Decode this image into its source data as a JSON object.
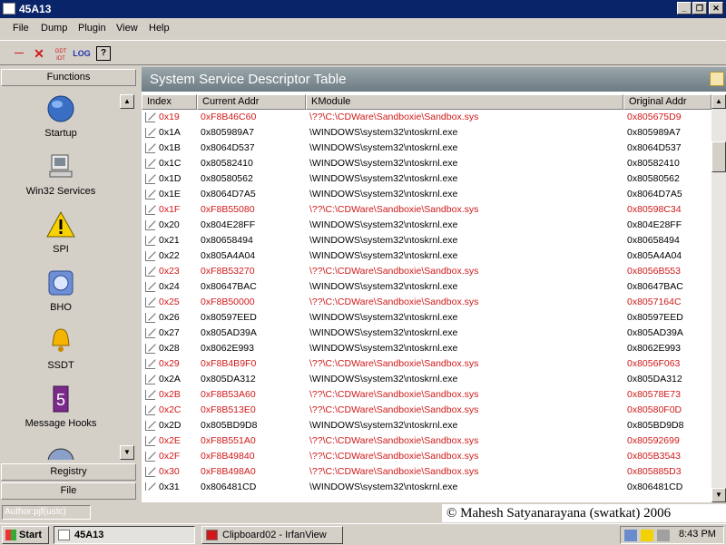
{
  "window": {
    "title": "45A13"
  },
  "window_controls": {
    "minimize": "_",
    "restore": "❐",
    "close": "✕"
  },
  "menu": [
    "File",
    "Dump",
    "Plugin",
    "View",
    "Help"
  ],
  "toolbar": {
    "minus": "—",
    "delete": "✕",
    "gdt_idt": "GDT IDT",
    "log": "LOG",
    "help": "?"
  },
  "left_panel": {
    "header": "Functions",
    "items": [
      "Startup",
      "Win32 Services",
      "SPI",
      "BHO",
      "SSDT",
      "Message Hooks"
    ],
    "footer_groups": [
      "Registry",
      "File"
    ]
  },
  "section": {
    "title": "System Service Descriptor Table"
  },
  "table": {
    "columns": [
      "Index",
      "Current Addr",
      "KModule",
      "Original Addr"
    ],
    "rows": [
      {
        "index": "0x19",
        "current": "0xF8B46C60",
        "module": "\\??\\C:\\CDWare\\Sandboxie\\Sandbox.sys",
        "original": "0x805675D9",
        "hooked": true
      },
      {
        "index": "0x1A",
        "current": "0x805989A7",
        "module": "\\WINDOWS\\system32\\ntoskrnl.exe",
        "original": "0x805989A7",
        "hooked": false
      },
      {
        "index": "0x1B",
        "current": "0x8064D537",
        "module": "\\WINDOWS\\system32\\ntoskrnl.exe",
        "original": "0x8064D537",
        "hooked": false
      },
      {
        "index": "0x1C",
        "current": "0x80582410",
        "module": "\\WINDOWS\\system32\\ntoskrnl.exe",
        "original": "0x80582410",
        "hooked": false
      },
      {
        "index": "0x1D",
        "current": "0x80580562",
        "module": "\\WINDOWS\\system32\\ntoskrnl.exe",
        "original": "0x80580562",
        "hooked": false
      },
      {
        "index": "0x1E",
        "current": "0x8064D7A5",
        "module": "\\WINDOWS\\system32\\ntoskrnl.exe",
        "original": "0x8064D7A5",
        "hooked": false
      },
      {
        "index": "0x1F",
        "current": "0xF8B55080",
        "module": "\\??\\C:\\CDWare\\Sandboxie\\Sandbox.sys",
        "original": "0x80598C34",
        "hooked": true
      },
      {
        "index": "0x20",
        "current": "0x804E28FF",
        "module": "\\WINDOWS\\system32\\ntoskrnl.exe",
        "original": "0x804E28FF",
        "hooked": false
      },
      {
        "index": "0x21",
        "current": "0x80658494",
        "module": "\\WINDOWS\\system32\\ntoskrnl.exe",
        "original": "0x80658494",
        "hooked": false
      },
      {
        "index": "0x22",
        "current": "0x805A4A04",
        "module": "\\WINDOWS\\system32\\ntoskrnl.exe",
        "original": "0x805A4A04",
        "hooked": false
      },
      {
        "index": "0x23",
        "current": "0xF8B53270",
        "module": "\\??\\C:\\CDWare\\Sandboxie\\Sandbox.sys",
        "original": "0x8056B553",
        "hooked": true
      },
      {
        "index": "0x24",
        "current": "0x80647BAC",
        "module": "\\WINDOWS\\system32\\ntoskrnl.exe",
        "original": "0x80647BAC",
        "hooked": false
      },
      {
        "index": "0x25",
        "current": "0xF8B50000",
        "module": "\\??\\C:\\CDWare\\Sandboxie\\Sandbox.sys",
        "original": "0x8057164C",
        "hooked": true
      },
      {
        "index": "0x26",
        "current": "0x80597EED",
        "module": "\\WINDOWS\\system32\\ntoskrnl.exe",
        "original": "0x80597EED",
        "hooked": false
      },
      {
        "index": "0x27",
        "current": "0x805AD39A",
        "module": "\\WINDOWS\\system32\\ntoskrnl.exe",
        "original": "0x805AD39A",
        "hooked": false
      },
      {
        "index": "0x28",
        "current": "0x8062E993",
        "module": "\\WINDOWS\\system32\\ntoskrnl.exe",
        "original": "0x8062E993",
        "hooked": false
      },
      {
        "index": "0x29",
        "current": "0xF8B4B9F0",
        "module": "\\??\\C:\\CDWare\\Sandboxie\\Sandbox.sys",
        "original": "0x8056F063",
        "hooked": true
      },
      {
        "index": "0x2A",
        "current": "0x805DA312",
        "module": "\\WINDOWS\\system32\\ntoskrnl.exe",
        "original": "0x805DA312",
        "hooked": false
      },
      {
        "index": "0x2B",
        "current": "0xF8B53A60",
        "module": "\\??\\C:\\CDWare\\Sandboxie\\Sandbox.sys",
        "original": "0x80578E73",
        "hooked": true
      },
      {
        "index": "0x2C",
        "current": "0xF8B513E0",
        "module": "\\??\\C:\\CDWare\\Sandboxie\\Sandbox.sys",
        "original": "0x80580F0D",
        "hooked": true
      },
      {
        "index": "0x2D",
        "current": "0x805BD9D8",
        "module": "\\WINDOWS\\system32\\ntoskrnl.exe",
        "original": "0x805BD9D8",
        "hooked": false
      },
      {
        "index": "0x2E",
        "current": "0xF8B551A0",
        "module": "\\??\\C:\\CDWare\\Sandboxie\\Sandbox.sys",
        "original": "0x80592699",
        "hooked": true
      },
      {
        "index": "0x2F",
        "current": "0xF8B49840",
        "module": "\\??\\C:\\CDWare\\Sandboxie\\Sandbox.sys",
        "original": "0x805B3543",
        "hooked": true
      },
      {
        "index": "0x30",
        "current": "0xF8B498A0",
        "module": "\\??\\C:\\CDWare\\Sandboxie\\Sandbox.sys",
        "original": "0x805885D3",
        "hooked": true
      },
      {
        "index": "0x31",
        "current": "0x806481CD",
        "module": "\\WINDOWS\\system32\\ntoskrnl.exe",
        "original": "0x806481CD",
        "hooked": false
      }
    ]
  },
  "status": {
    "author": "Author:pjf(ustc)",
    "copyright": "© Mahesh Satyanarayana (swatkat) 2006"
  },
  "taskbar": {
    "start": "Start",
    "tasks": [
      "45A13",
      "Clipboard02 - IrfanView"
    ],
    "clock": "8:43 PM"
  },
  "colors": {
    "hooked": "#d01818",
    "normal": "#000000",
    "titlebar": "#0a246a"
  }
}
